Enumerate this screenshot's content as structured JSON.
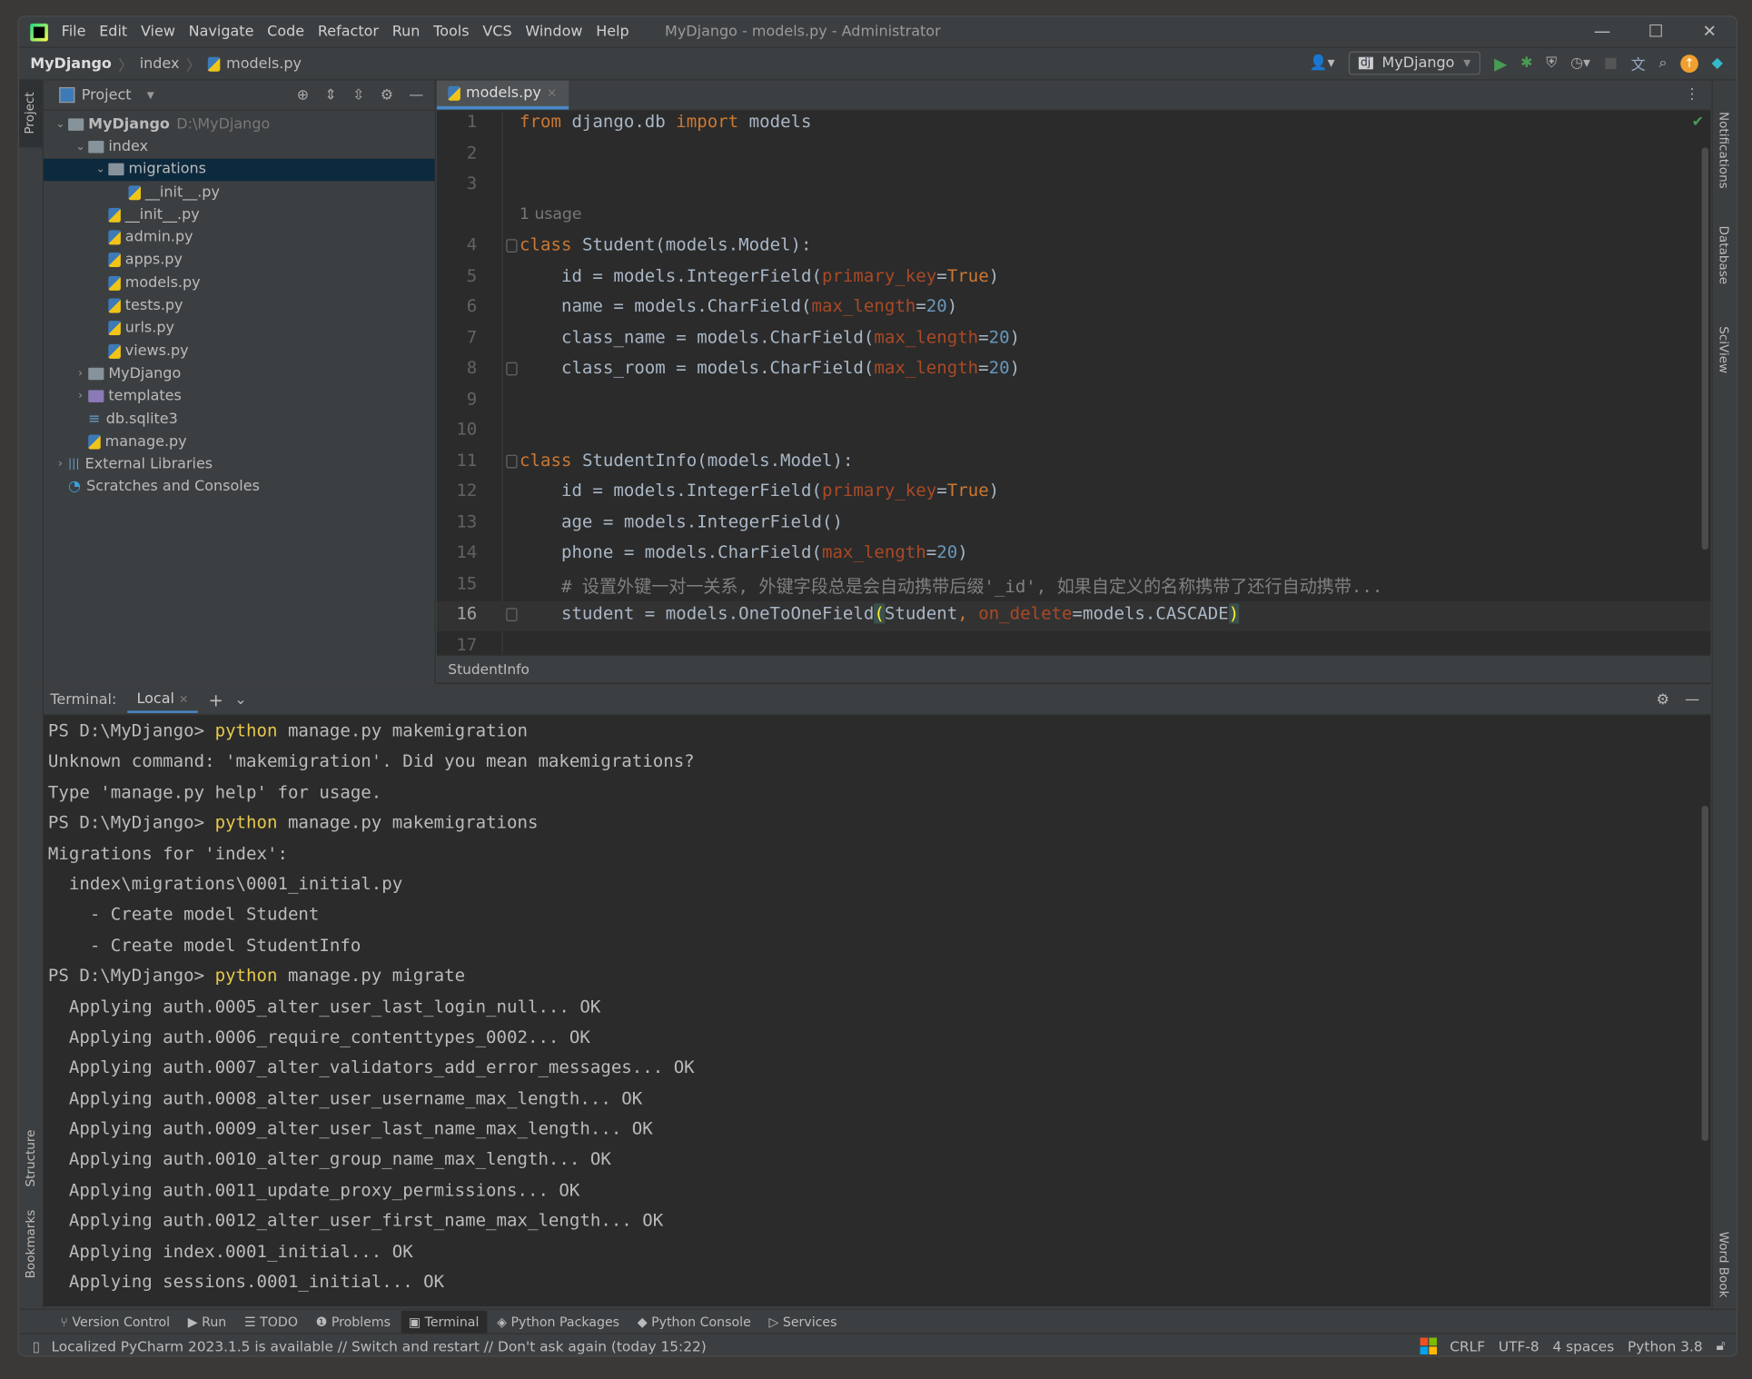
{
  "window": {
    "title": "MyDjango - models.py - Administrator",
    "menu": [
      "File",
      "Edit",
      "View",
      "Navigate",
      "Code",
      "Refactor",
      "Run",
      "Tools",
      "VCS",
      "Window",
      "Help"
    ]
  },
  "breadcrumb": [
    "MyDjango",
    "index",
    "models.py"
  ],
  "run_config": "MyDjango",
  "left_stripe": {
    "top": "Project",
    "structure": "Structure",
    "bookmarks": "Bookmarks"
  },
  "right_stripe": [
    "Notifications",
    "Database",
    "SciView",
    "Word Book"
  ],
  "project": {
    "title": "Project",
    "tree": [
      {
        "label": "MyDjango",
        "path": "D:\\MyDjango",
        "depth": 0,
        "type": "folder",
        "open": true
      },
      {
        "label": "index",
        "depth": 1,
        "type": "folder",
        "open": true
      },
      {
        "label": "migrations",
        "depth": 2,
        "type": "folder",
        "open": true,
        "selected": true
      },
      {
        "label": "__init__.py",
        "depth": 3,
        "type": "py"
      },
      {
        "label": "__init__.py",
        "depth": 2,
        "type": "py"
      },
      {
        "label": "admin.py",
        "depth": 2,
        "type": "py"
      },
      {
        "label": "apps.py",
        "depth": 2,
        "type": "py"
      },
      {
        "label": "models.py",
        "depth": 2,
        "type": "py"
      },
      {
        "label": "tests.py",
        "depth": 2,
        "type": "py"
      },
      {
        "label": "urls.py",
        "depth": 2,
        "type": "py"
      },
      {
        "label": "views.py",
        "depth": 2,
        "type": "py"
      },
      {
        "label": "MyDjango",
        "depth": 1,
        "type": "folder",
        "open": false
      },
      {
        "label": "templates",
        "depth": 1,
        "type": "folder-purple",
        "open": false
      },
      {
        "label": "db.sqlite3",
        "depth": 1,
        "type": "db"
      },
      {
        "label": "manage.py",
        "depth": 1,
        "type": "py"
      },
      {
        "label": "External Libraries",
        "depth": 0,
        "type": "lib",
        "open": false
      },
      {
        "label": "Scratches and Consoles",
        "depth": 0,
        "type": "scratch"
      }
    ]
  },
  "editor": {
    "tab": "models.py",
    "usage_hint": "1 usage",
    "structure_crumb": "StudentInfo",
    "lines": [
      {
        "n": "1",
        "html": "<span class=\"kw\">from</span> django.db <span class=\"kw\">import</span> models"
      },
      {
        "n": "2",
        "html": ""
      },
      {
        "n": "3",
        "html": ""
      },
      {
        "n": "4",
        "html": "<span class=\"kw\">class</span> Student(models.Model):"
      },
      {
        "n": "5",
        "html": "    id = models.IntegerField(<span class=\"pa\">primary_key</span>=<span class=\"kw\">True</span>)"
      },
      {
        "n": "6",
        "html": "    name = models.CharField(<span class=\"pa\">max_length</span>=<span class=\"nu\">20</span>)"
      },
      {
        "n": "7",
        "html": "    class_name = models.CharField(<span class=\"pa\">max_length</span>=<span class=\"nu\">20</span>)"
      },
      {
        "n": "8",
        "html": "    class_room = models.CharField(<span class=\"pa\">max_length</span>=<span class=\"nu\">20</span>)"
      },
      {
        "n": "9",
        "html": ""
      },
      {
        "n": "10",
        "html": ""
      },
      {
        "n": "11",
        "html": "<span class=\"kw\">class</span> StudentInfo(models.Model):"
      },
      {
        "n": "12",
        "html": "    id = models.IntegerField(<span class=\"pa\">primary_key</span>=<span class=\"kw\">True</span>)"
      },
      {
        "n": "13",
        "html": "    age = models.IntegerField()"
      },
      {
        "n": "14",
        "html": "    phone = models.CharField(<span class=\"pa\">max_length</span>=<span class=\"nu\">20</span>)"
      },
      {
        "n": "15",
        "html": "    <span class=\"cm\"># 设置外键一对一关系, 外键字段总是会自动携带后缀'_id', 如果自定义的名称携带了还行自动携带...</span>"
      },
      {
        "n": "16",
        "html": "    student = models.OneToOneField<span class=\"br\">(</span>Student<span class=\"kw\">,</span> <span class=\"pa\">on_delete</span>=models.CASCADE<span class=\"br\">)</span>"
      },
      {
        "n": "17",
        "html": ""
      }
    ]
  },
  "terminal": {
    "label": "Terminal:",
    "tab": "Local",
    "lines": [
      {
        "prompt": "PS D:\\MyDjango> ",
        "cmd": "python",
        "rest": " manage.py makemigration"
      },
      {
        "text": "Unknown command: 'makemigration'. Did you mean makemigrations?"
      },
      {
        "text": "Type 'manage.py help' for usage."
      },
      {
        "prompt": "PS D:\\MyDjango> ",
        "cmd": "python",
        "rest": " manage.py makemigrations"
      },
      {
        "text": "Migrations for 'index':"
      },
      {
        "text": "  index\\migrations\\0001_initial.py"
      },
      {
        "text": "    - Create model Student"
      },
      {
        "text": "    - Create model StudentInfo"
      },
      {
        "prompt": "PS D:\\MyDjango> ",
        "cmd": "python",
        "rest": " manage.py migrate"
      },
      {
        "text": "  Applying auth.0005_alter_user_last_login_null... OK"
      },
      {
        "text": "  Applying auth.0006_require_contenttypes_0002... OK"
      },
      {
        "text": "  Applying auth.0007_alter_validators_add_error_messages... OK"
      },
      {
        "text": "  Applying auth.0008_alter_user_username_max_length... OK"
      },
      {
        "text": "  Applying auth.0009_alter_user_last_name_max_length... OK"
      },
      {
        "text": "  Applying auth.0010_alter_group_name_max_length... OK"
      },
      {
        "text": "  Applying auth.0011_update_proxy_permissions... OK"
      },
      {
        "text": "  Applying auth.0012_alter_user_first_name_max_length... OK"
      },
      {
        "text": "  Applying index.0001_initial... OK"
      },
      {
        "text": "  Applying sessions.0001_initial... OK"
      }
    ]
  },
  "tool_windows": [
    {
      "label": "Version Control"
    },
    {
      "label": "Run"
    },
    {
      "label": "TODO"
    },
    {
      "label": "Problems"
    },
    {
      "label": "Terminal",
      "active": true
    },
    {
      "label": "Python Packages"
    },
    {
      "label": "Python Console"
    },
    {
      "label": "Services"
    }
  ],
  "status": {
    "message": "Localized PyCharm 2023.1.5 is available // Switch and restart // Don't ask again (today 15:22)",
    "line_sep": "CRLF",
    "encoding": "UTF-8",
    "indent": "4 spaces",
    "interpreter": "Python 3.8"
  }
}
